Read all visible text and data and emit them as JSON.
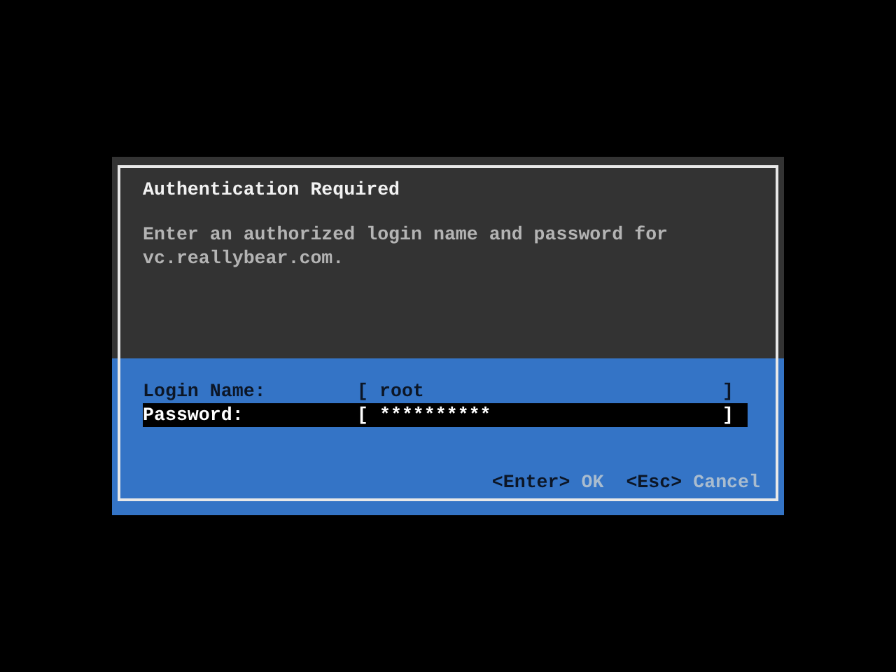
{
  "dialog": {
    "title": "Authentication Required",
    "message": "Enter an authorized login name and password for vc.reallybear.com.",
    "fields": [
      {
        "label": "Login Name:",
        "open_bracket": "[",
        "value": "root",
        "close_bracket": "]",
        "selected": false
      },
      {
        "label": "Password:",
        "open_bracket": "[",
        "value": "**********",
        "close_bracket": "]",
        "selected": true
      }
    ],
    "buttons": [
      {
        "key": "<Enter>",
        "action": "OK"
      },
      {
        "key": "<Esc>",
        "action": "Cancel"
      }
    ]
  }
}
